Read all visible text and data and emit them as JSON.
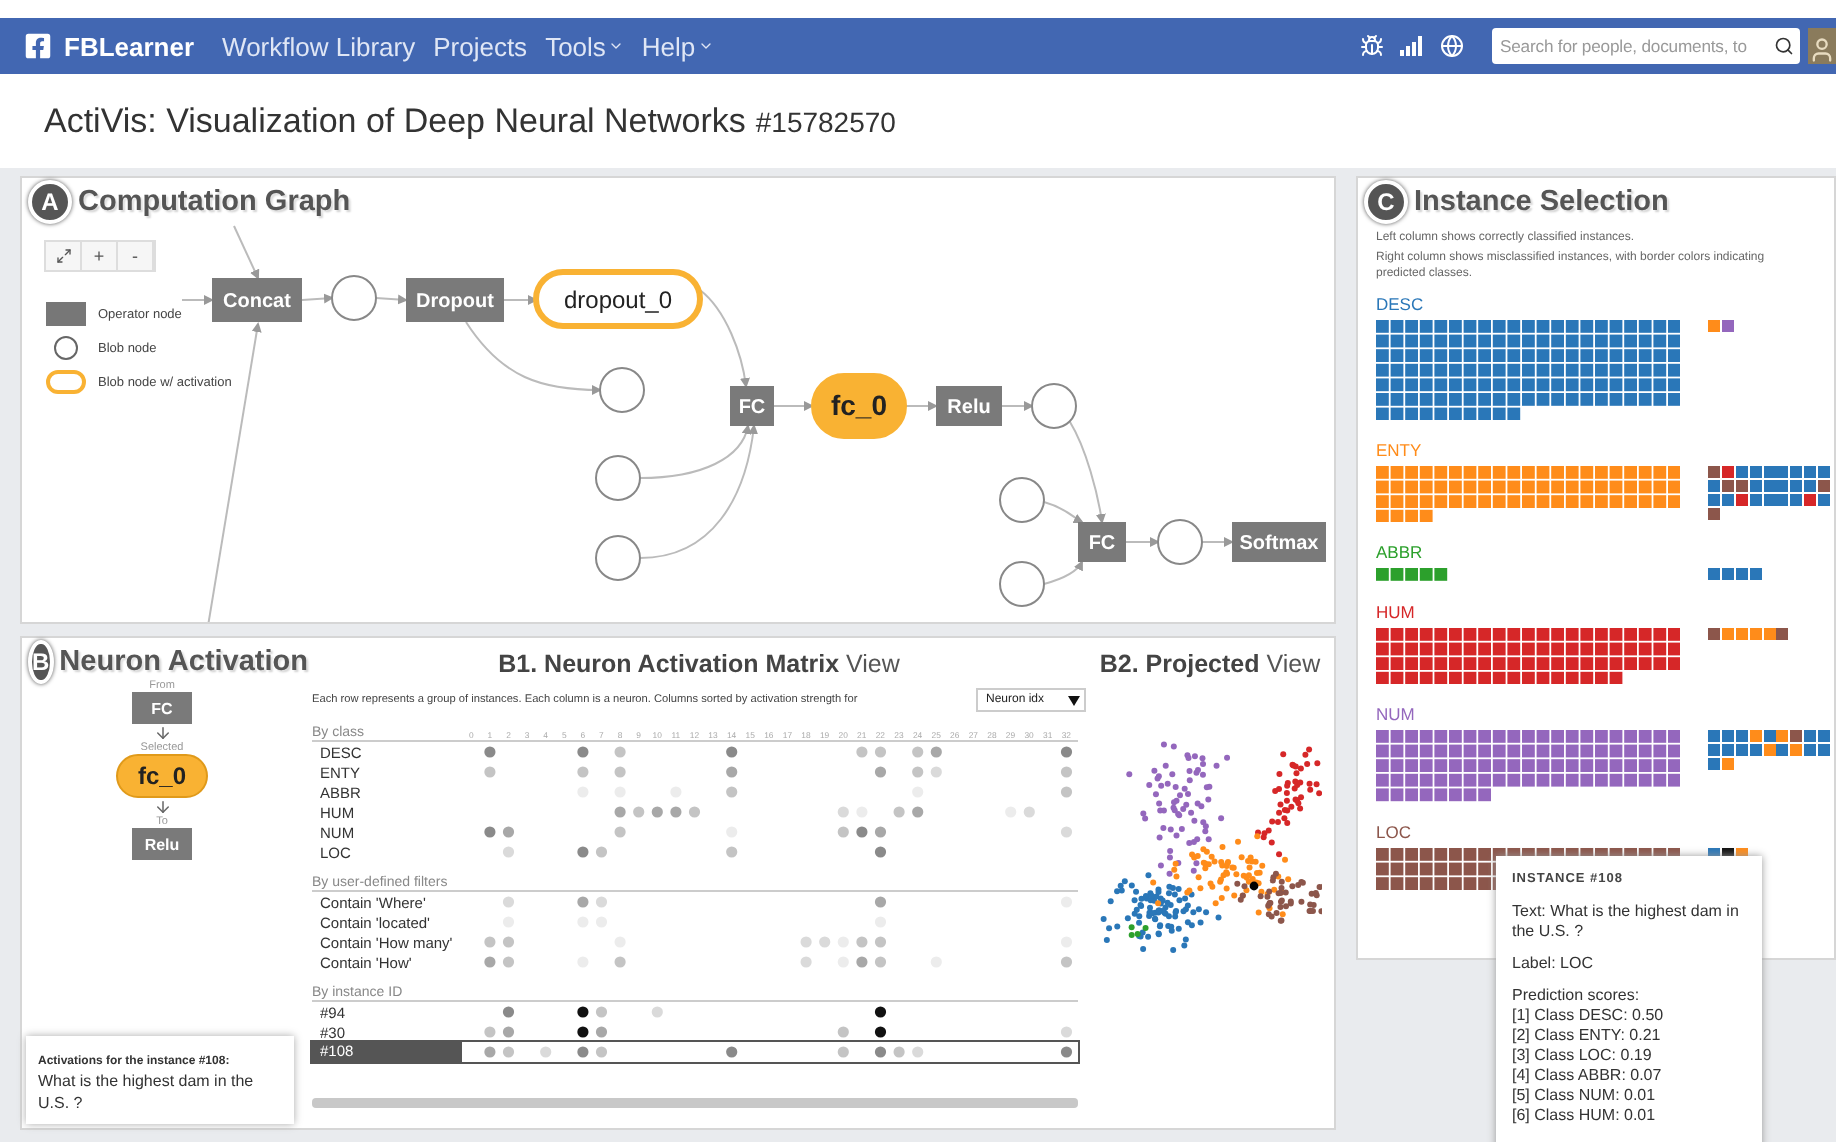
{
  "nav": {
    "brand": "FBLearner",
    "links": [
      {
        "label": "Workflow Library",
        "menu": false
      },
      {
        "label": "Projects",
        "menu": false
      },
      {
        "label": "Tools",
        "menu": true
      },
      {
        "label": "Help",
        "menu": true
      }
    ],
    "search": {
      "placeholder": "Search for people, documents, to"
    }
  },
  "page_title": {
    "name": "ActiVis: Visualization of Deep Neural Networks",
    "id": "#15782570"
  },
  "graph_panel": {
    "badge": "A",
    "title": "Computation Graph",
    "zoom_buttons": [
      {
        "kind": "fit"
      },
      {
        "kind": "text",
        "label": "+"
      },
      {
        "kind": "text",
        "label": "-"
      }
    ],
    "legend": [
      {
        "kind": "operator",
        "label": "Operator node"
      },
      {
        "kind": "blob",
        "label": "Blob node"
      },
      {
        "kind": "activation",
        "label": "Blob node w/ activation"
      }
    ],
    "nodes": [
      {
        "kind": "operator",
        "label": "Concat"
      },
      {
        "kind": "blob"
      },
      {
        "kind": "operator",
        "label": "Dropout"
      },
      {
        "kind": "activation",
        "label": "dropout_0",
        "selected": false
      },
      {
        "kind": "blob"
      },
      {
        "kind": "operator",
        "label": "FC"
      },
      {
        "kind": "activation",
        "label": "fc_0",
        "selected": true
      },
      {
        "kind": "operator",
        "label": "Relu"
      },
      {
        "kind": "blob"
      },
      {
        "kind": "blob"
      },
      {
        "kind": "blob"
      },
      {
        "kind": "blob"
      },
      {
        "kind": "blob"
      },
      {
        "kind": "operator",
        "label": "FC"
      },
      {
        "kind": "blob"
      },
      {
        "kind": "operator",
        "label": "Softmax"
      }
    ]
  },
  "neuron_panel": {
    "badge": "B",
    "title": "Neuron Activation",
    "flow": [
      {
        "caption": "From",
        "node": "FC",
        "kind": "operator"
      },
      {
        "caption": "Selected",
        "node": "fc_0",
        "kind": "activation"
      },
      {
        "caption": "To",
        "node": "Relu",
        "kind": "operator"
      }
    ],
    "instance_note": {
      "title": "Activations for the instance #108:",
      "text": "What is the highest dam in the U.S. ?"
    },
    "matrix": {
      "title": "**B1. Neuron Activation Matrix** View",
      "description": "Each row represents a group of instances. Each column is a neuron. Columns sorted by activation strength for",
      "sort_select": {
        "value": "Neuron idx"
      },
      "columns": [
        "0",
        "1",
        "2",
        "3",
        "4",
        "5",
        "6",
        "7",
        "8",
        "9",
        "10",
        "11",
        "12",
        "13",
        "14",
        "15",
        "16",
        "17",
        "18",
        "19",
        "20",
        "21",
        "22",
        "23",
        "24",
        "25",
        "26",
        "27",
        "28",
        "29",
        "30",
        "31",
        "32"
      ],
      "sections": [
        {
          "title": "By class",
          "rows": [
            {
              "label": "DESC",
              "selected": false
            },
            {
              "label": "ENTY",
              "selected": false
            },
            {
              "label": "ABBR",
              "selected": false
            },
            {
              "label": "HUM",
              "selected": false
            },
            {
              "label": "NUM",
              "selected": false
            },
            {
              "label": "LOC",
              "selected": false
            }
          ]
        },
        {
          "title": "By user-defined filters",
          "rows": [
            {
              "label": "Contain 'Where'",
              "selected": false
            },
            {
              "label": "Contain 'located'",
              "selected": false
            },
            {
              "label": "Contain 'How many'",
              "selected": false
            },
            {
              "label": "Contain 'How'",
              "selected": false
            }
          ]
        },
        {
          "title": "By instance ID",
          "rows": [
            {
              "label": "#94",
              "selected": false
            },
            {
              "label": "#30",
              "selected": false
            },
            {
              "label": "#108",
              "selected": true
            }
          ]
        }
      ]
    },
    "projected": {
      "title": "**B2. Projected** View"
    }
  },
  "instance_panel": {
    "badge": "C",
    "title": "Instance Selection",
    "description": [
      "Left column shows correctly classified instances.",
      "Right column shows misclassified instances, with border colors indicating predicted classes."
    ],
    "classes": [
      {
        "label": "DESC",
        "color": "#2a77b8",
        "misclassified": [
          {
            "color": "#ff8c1a"
          },
          {
            "color": "#9467bd"
          }
        ]
      },
      {
        "label": "ENTY",
        "color": "#ff8c1a",
        "misclassified": [
          {
            "color": "#8c564b"
          },
          {
            "color": "#d62728"
          },
          {
            "color": "#2a77b8"
          },
          {
            "color": "#2a77b8"
          },
          {
            "color": "#2a77b8"
          },
          {
            "color": "#2a77b8"
          },
          {
            "color": "#2a77b8"
          },
          {
            "color": "#2a77b8"
          },
          {
            "color": "#2a77b8"
          },
          {
            "color": "#2a77b8"
          },
          {
            "color": "#8c564b"
          },
          {
            "color": "#8c564b"
          },
          {
            "color": "#2a77b8"
          },
          {
            "color": "#2a77b8"
          },
          {
            "color": "#2a77b8"
          },
          {
            "color": "#2a77b8"
          },
          {
            "color": "#2a77b8"
          },
          {
            "color": "#8c564b"
          },
          {
            "color": "#2a77b8"
          },
          {
            "color": "#2a77b8"
          },
          {
            "color": "#d62728"
          },
          {
            "color": "#2a77b8"
          },
          {
            "color": "#2a77b8"
          },
          {
            "color": "#2a77b8"
          },
          {
            "color": "#2a77b8"
          },
          {
            "color": "#d62728"
          },
          {
            "color": "#2a77b8"
          },
          {
            "color": "#8c564b"
          }
        ]
      },
      {
        "label": "ABBR",
        "color": "#2ca02c",
        "misclassified": [
          {
            "color": "#2a77b8"
          },
          {
            "color": "#2a77b8"
          },
          {
            "color": "#2a77b8"
          },
          {
            "color": "#2a77b8"
          }
        ]
      },
      {
        "label": "HUM",
        "color": "#d62728",
        "misclassified": [
          {
            "color": "#8c564b"
          },
          {
            "color": "#ff8c1a"
          },
          {
            "color": "#ff8c1a"
          },
          {
            "color": "#ff8c1a"
          },
          {
            "color": "#ff8c1a"
          },
          {
            "color": "#8c564b"
          }
        ]
      },
      {
        "label": "NUM",
        "color": "#9467bd",
        "misclassified": [
          {
            "color": "#2a77b8"
          },
          {
            "color": "#2a77b8"
          },
          {
            "color": "#2a77b8"
          },
          {
            "color": "#ff8c1a"
          },
          {
            "color": "#2a77b8"
          },
          {
            "color": "#ff8c1a"
          },
          {
            "color": "#8c564b"
          },
          {
            "color": "#2a77b8"
          },
          {
            "color": "#2a77b8"
          },
          {
            "color": "#2a77b8"
          },
          {
            "color": "#2a77b8"
          },
          {
            "color": "#2a77b8"
          },
          {
            "color": "#2a77b8"
          },
          {
            "color": "#ff8c1a"
          },
          {
            "color": "#2a77b8"
          },
          {
            "color": "#ff8c1a"
          },
          {
            "color": "#2a77b8"
          },
          {
            "color": "#2a77b8"
          },
          {
            "color": "#2a77b8"
          },
          {
            "color": "#ff8c1a"
          }
        ]
      },
      {
        "label": "LOC",
        "color": "#8c564b",
        "misclassified": [
          {
            "color": "#2a77b8"
          },
          {
            "color": "#111111"
          },
          {
            "color": "#ff8c1a"
          }
        ]
      }
    ]
  },
  "tooltip": {
    "title": "INSTANCE #108",
    "text": "Text: What is the highest dam in the U.S. ?",
    "label": "Label: LOC",
    "scores_title": "Prediction scores:",
    "scores": [
      "[1] Class DESC: 0.50",
      "[2] Class ENTY: 0.21",
      "[3] Class LOC: 0.19",
      "[4] Class ABBR: 0.07",
      "[5] Class NUM: 0.01",
      "[6] Class HUM: 0.01"
    ]
  }
}
